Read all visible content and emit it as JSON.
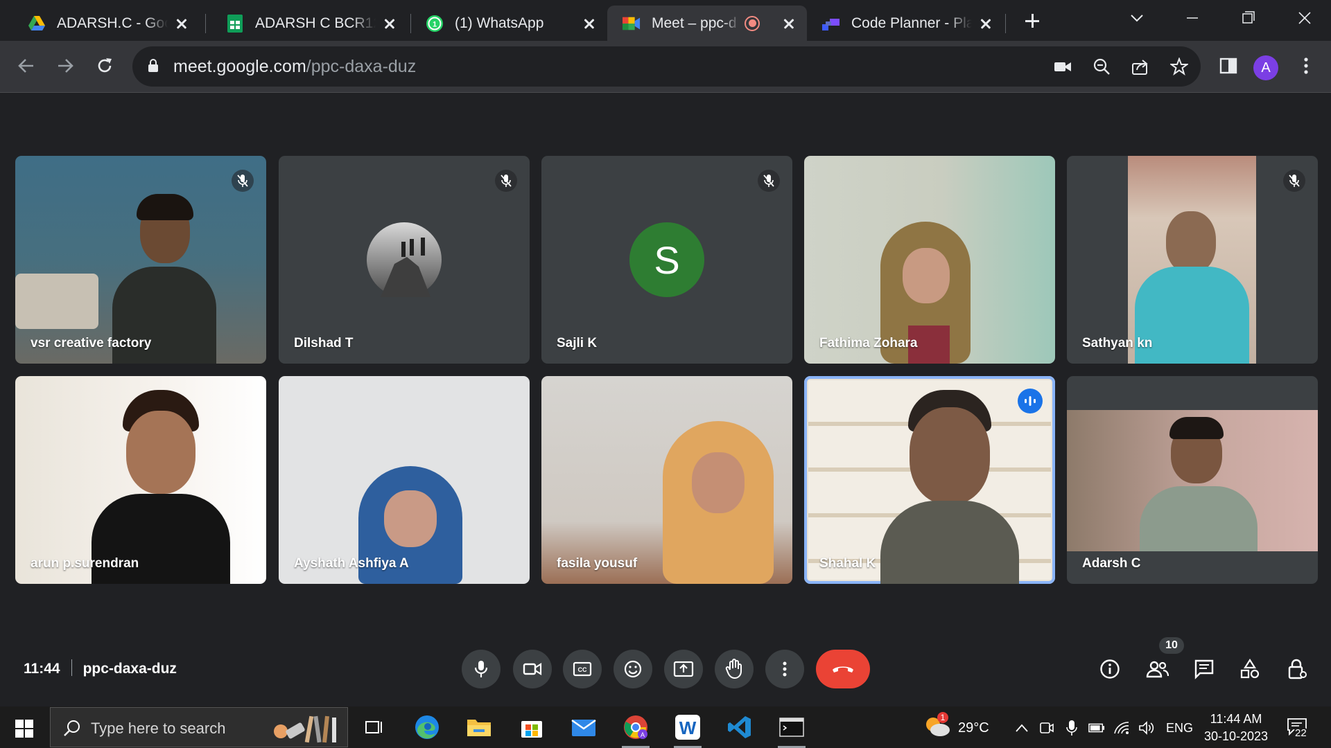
{
  "browser": {
    "tabs": [
      {
        "title": "ADARSH.C - Goog",
        "icon": "google-drive-icon"
      },
      {
        "title": "ADARSH C BCR12",
        "icon": "google-sheets-icon"
      },
      {
        "title": "(1) WhatsApp",
        "icon": "whatsapp-icon"
      },
      {
        "title": "Meet – ppc-d",
        "icon": "google-meet-icon",
        "active": true,
        "recording": true
      },
      {
        "title": "Code Planner - Pla",
        "icon": "code-planner-icon"
      }
    ],
    "address": {
      "host": "meet.google.com",
      "path": "/ppc-daxa-duz"
    },
    "profile_initial": "A"
  },
  "meet": {
    "participants": [
      {
        "name": "vsr creative factory",
        "muted": true,
        "kind": "video"
      },
      {
        "name": "Dilshad T",
        "muted": true,
        "kind": "photo-avatar"
      },
      {
        "name": "Sajli K",
        "muted": true,
        "kind": "letter-avatar",
        "initial": "S",
        "color": "#2e7d32"
      },
      {
        "name": "Fathima Zohara",
        "muted": false,
        "kind": "video"
      },
      {
        "name": "Sathyan kn",
        "muted": true,
        "kind": "video"
      },
      {
        "name": "arun p.surendran",
        "muted": false,
        "kind": "video"
      },
      {
        "name": "Ayshath Ashfiya A",
        "muted": false,
        "kind": "video"
      },
      {
        "name": "fasila yousuf",
        "muted": false,
        "kind": "video"
      },
      {
        "name": "Shahal K",
        "muted": false,
        "kind": "video",
        "speaking": true
      },
      {
        "name": "Adarsh C",
        "muted": false,
        "kind": "video"
      }
    ],
    "time": "11:44",
    "meeting_code": "ppc-daxa-duz",
    "participant_count": "10",
    "accent": "#8ab4f8",
    "end_call_color": "#ea4335"
  },
  "taskbar": {
    "search_placeholder": "Type here to search",
    "weather": "29°C",
    "weather_badge": "1",
    "language": "ENG",
    "time": "11:44 AM",
    "date": "30-10-2023",
    "notifications": "22"
  }
}
